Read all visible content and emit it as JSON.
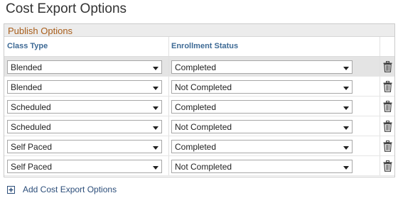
{
  "page": {
    "title": "Cost Export Options"
  },
  "grid": {
    "title": "Publish Options",
    "columns": {
      "class_type": "Class Type",
      "enrollment_status": "Enrollment Status"
    },
    "rows": [
      {
        "class_type": "Blended",
        "enrollment_status": "Completed"
      },
      {
        "class_type": "Blended",
        "enrollment_status": "Not Completed"
      },
      {
        "class_type": "Scheduled",
        "enrollment_status": "Completed"
      },
      {
        "class_type": "Scheduled",
        "enrollment_status": "Not Completed"
      },
      {
        "class_type": "Self Paced",
        "enrollment_status": "Completed"
      },
      {
        "class_type": "Self Paced",
        "enrollment_status": "Not Completed"
      }
    ]
  },
  "footer": {
    "add_label": "Add Cost Export Options"
  },
  "icons": {
    "row_action": "trash-icon",
    "add": "plus-icon"
  },
  "colors": {
    "grid_title": "#a85d1a",
    "column_header": "#3e6a95",
    "link": "#2c4e7a",
    "selected_row": "#e4e4e4"
  }
}
